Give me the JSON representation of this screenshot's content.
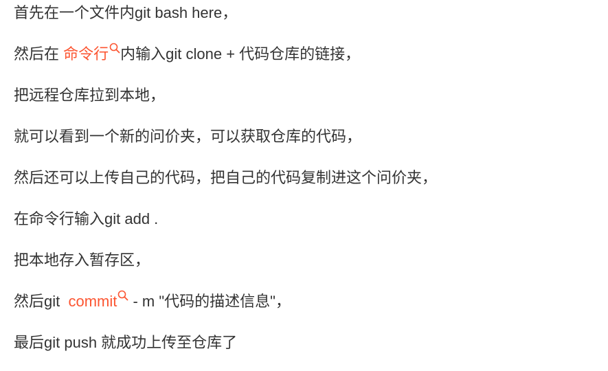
{
  "article": {
    "paragraphs": [
      {
        "text": "首先在一个文件内git bash here，"
      },
      {
        "before": "然后在 ",
        "link": "命令行",
        "after": "内输入git clone + 代码仓库的链接，",
        "link_icon": "search-icon"
      },
      {
        "text": "把远程仓库拉到本地，"
      },
      {
        "text": "就可以看到一个新的问价夹，可以获取仓库的代码，"
      },
      {
        "text": "然后还可以上传自己的代码，把自己的代码复制进这个问价夹，"
      },
      {
        "text": "在命令行输入git add ."
      },
      {
        "text": "把本地存入暂存区，"
      },
      {
        "before": "然后git  ",
        "link": "commit",
        "after": " - m \"代码的描述信息\"，",
        "link_icon": "search-icon"
      },
      {
        "text": "最后git push 就成功上传至仓库了"
      }
    ]
  },
  "colors": {
    "text": "#333333",
    "keyword_link": "#fc5531",
    "background": "#ffffff"
  }
}
